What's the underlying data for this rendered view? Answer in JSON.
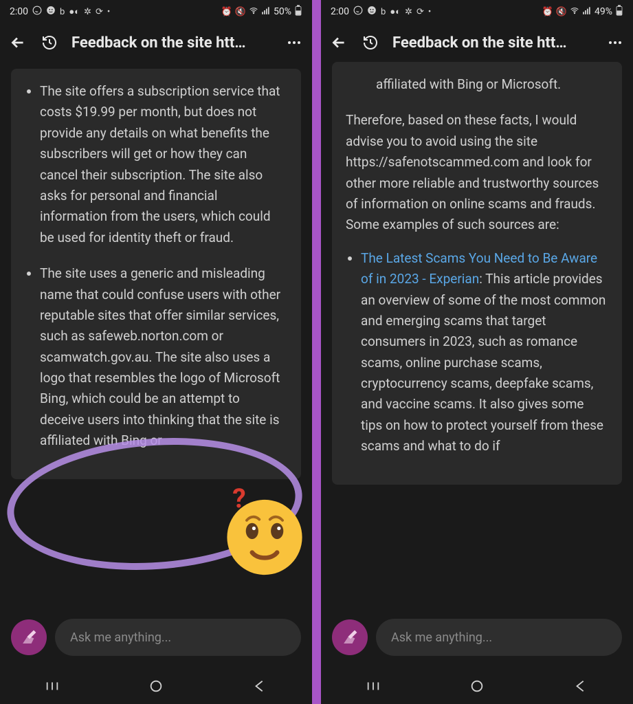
{
  "left": {
    "status": {
      "time": "2:00",
      "battery": "50%",
      "icons_left": [
        "whatsapp",
        "smiley",
        "bing",
        "dotpair",
        "fan",
        "loop",
        "dot"
      ],
      "icons_right": [
        "alarm",
        "mute",
        "wifi",
        "signal",
        "signal2"
      ]
    },
    "header": {
      "title": "Feedback on the site htt…"
    },
    "content": {
      "bullet1": "The site offers a subscription service that costs $19.99 per month, but does not provide any details on what benefits the subscribers will get or how they can cancel their subscription. The site also asks for personal and financial information from the users, which could be used for identity theft or fraud.",
      "bullet2": "The site uses a generic and misleading name that could confuse users with other reputable sites that offer similar services, such as safeweb.norton.com or scamwatch.gov.au. The site also uses a logo that resembles the logo of Microsoft Bing, which could be an attempt to deceive users into thinking that the site is affiliated with Bing or"
    },
    "input_placeholder": "Ask me anything..."
  },
  "right": {
    "status": {
      "time": "2:00",
      "battery": "49%",
      "icons_left": [
        "whatsapp",
        "smiley",
        "bing",
        "dotpair",
        "fan",
        "loop",
        "dot"
      ],
      "icons_right": [
        "alarm",
        "mute",
        "wifi",
        "signal",
        "signal2"
      ]
    },
    "header": {
      "title": "Feedback on the site htt…"
    },
    "content": {
      "tail": "affiliated with Bing or Microsoft.",
      "para": "Therefore, based on these facts, I would advise you to avoid using the site https://safenotscammed.com and look for other more reliable and trustworthy sources of information on online scams and frauds. Some examples of such sources are:",
      "link_text": "The Latest Scams You Need to Be Aware of in 2023 - Experian",
      "link_after": ": This article provides an overview of some of the most common and emerging scams that target consumers in 2023, such as romance scams, online purchase scams, cryptocurrency scams, deepfake scams, and vaccine scams. It also gives some tips on how to protect yourself from these scams and what to do if"
    },
    "input_placeholder": "Ask me anything..."
  },
  "annotation": {
    "question_mark": "?",
    "emoji": "confused-face"
  }
}
